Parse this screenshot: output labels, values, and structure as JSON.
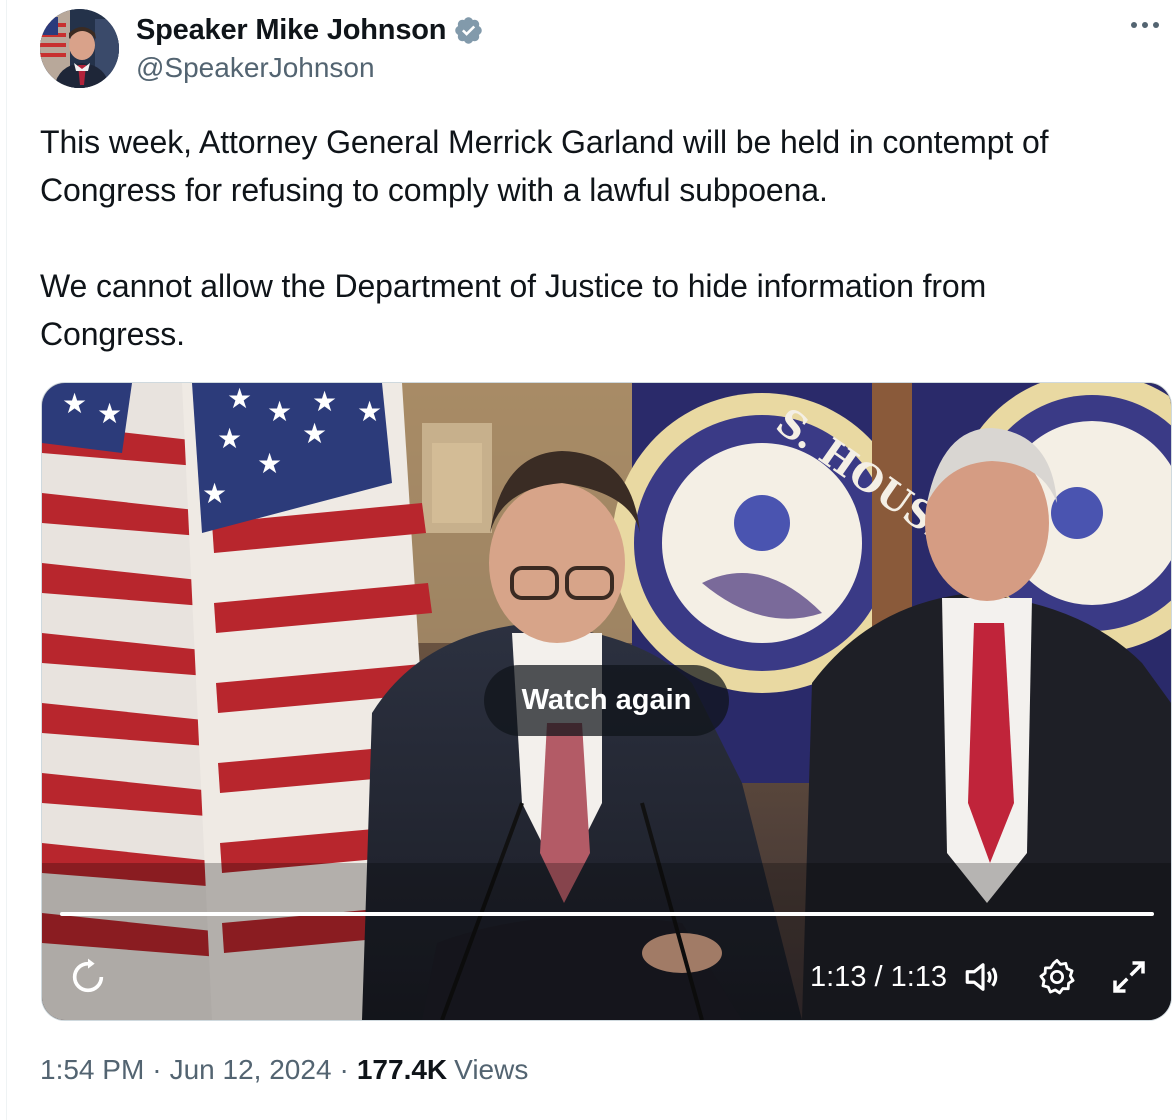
{
  "author": {
    "display_name": "Speaker Mike Johnson",
    "handle": "@SpeakerJohnson",
    "verified": true,
    "verified_color": "#829aab"
  },
  "tweet": {
    "paragraph_1": "This week, Attorney General Merrick Garland will be held in contempt of\nCongress for refusing to comply with a lawful subpoena.",
    "paragraph_2": "We cannot allow the Department of Justice to hide information from\nCongress."
  },
  "video": {
    "overlay_button": "Watch again",
    "time_display": "1:13 / 1:13",
    "progress": 1.0,
    "seal_text": "S. HOUSE",
    "icons": [
      "replay-icon",
      "volume-icon",
      "settings-icon",
      "fullscreen-icon"
    ]
  },
  "footer": {
    "time": "1:54 PM",
    "date": "Jun 12, 2024",
    "views_count": "177.4K",
    "views_label": "Views",
    "separator": "·"
  },
  "more_icon": "more-icon"
}
